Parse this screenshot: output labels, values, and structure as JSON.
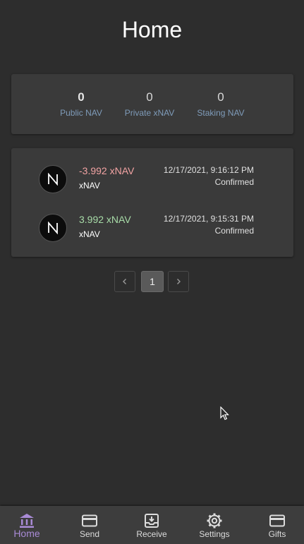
{
  "header": {
    "title": "Home"
  },
  "balances": [
    {
      "value": "0",
      "label": "Public NAV"
    },
    {
      "value": "0",
      "label": "Private xNAV"
    },
    {
      "value": "0",
      "label": "Staking NAV"
    }
  ],
  "transactions": [
    {
      "amount": "-3.992 xNAV",
      "unit": "xNAV",
      "date": "12/17/2021, 9:16:12 PM",
      "status": "Confirmed",
      "direction": "out",
      "color": "#f2a3a3"
    },
    {
      "amount": "3.992 xNAV",
      "unit": "xNAV",
      "date": "12/17/2021, 9:15:31 PM",
      "status": "Confirmed",
      "direction": "in",
      "color": "#a8dca8"
    }
  ],
  "pagination": {
    "current_page": "1",
    "prev_icon": "chevron-left-icon",
    "next_icon": "chevron-right-icon"
  },
  "bottom_nav": [
    {
      "label": "Home",
      "icon": "bank-icon",
      "active": true
    },
    {
      "label": "Send",
      "icon": "credit-card-icon",
      "active": false
    },
    {
      "label": "Receive",
      "icon": "inbox-download-icon",
      "active": false
    },
    {
      "label": "Settings",
      "icon": "gear-icon",
      "active": false
    },
    {
      "label": "Gifts",
      "icon": "card-icon",
      "active": false
    }
  ],
  "colors": {
    "background": "#2d2d2d",
    "card": "#3a3a3a",
    "accent": "#a98bd6",
    "balance_label": "#7f9cba",
    "negative": "#f2a3a3",
    "positive": "#a8dca8"
  }
}
